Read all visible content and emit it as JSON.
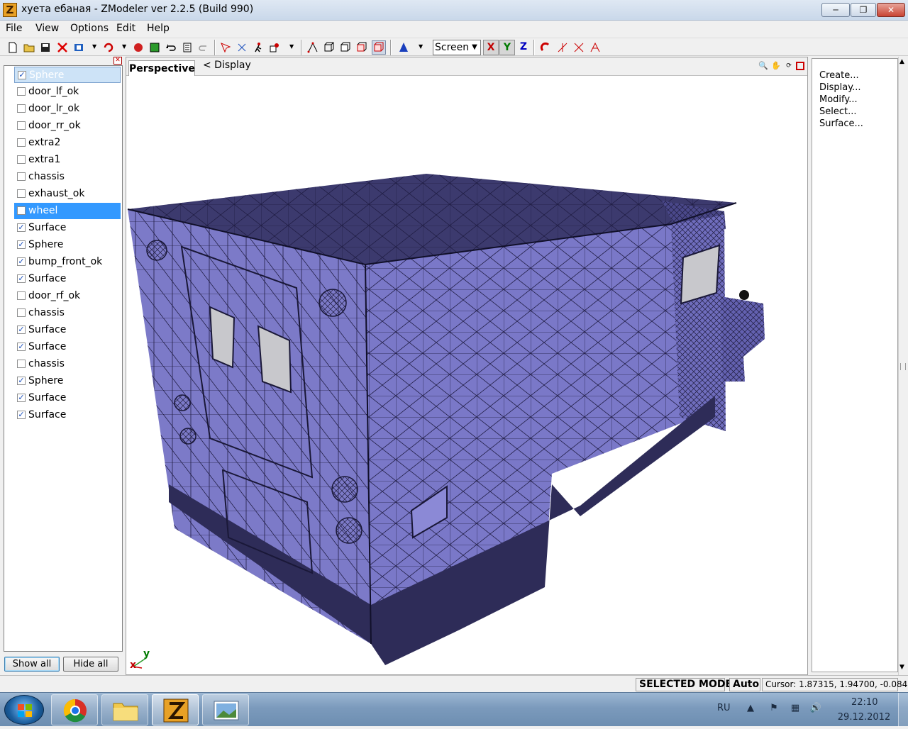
{
  "window": {
    "title": "хуета ебаная - ZModeler ver 2.2.5 (Build 990)",
    "app_icon_letter": "Z"
  },
  "menu": [
    "File",
    "View",
    "Options",
    "Edit",
    "Help"
  ],
  "toolbar": {
    "axis_mode": "Screen",
    "axes": [
      "X",
      "Y",
      "Z"
    ],
    "axis_colors": {
      "X": "#c00000",
      "Y": "#007a00",
      "Z": "#0000c0"
    }
  },
  "object_list": {
    "items": [
      {
        "name": "Sphere",
        "checked": true
      },
      {
        "name": "door_lf_ok",
        "checked": false
      },
      {
        "name": "door_lr_ok",
        "checked": false
      },
      {
        "name": "door_rr_ok",
        "checked": false
      },
      {
        "name": "extra2",
        "checked": false
      },
      {
        "name": "extra1",
        "checked": false
      },
      {
        "name": "chassis",
        "checked": false
      },
      {
        "name": "exhaust_ok",
        "checked": false
      },
      {
        "name": "wheel",
        "checked": false
      },
      {
        "name": "Surface",
        "checked": true
      },
      {
        "name": "Sphere",
        "checked": true
      },
      {
        "name": "bump_front_ok",
        "checked": true
      },
      {
        "name": "Surface",
        "checked": true
      },
      {
        "name": "door_rf_ok",
        "checked": false
      },
      {
        "name": "chassis",
        "checked": false
      },
      {
        "name": "Surface",
        "checked": true
      },
      {
        "name": "Surface",
        "checked": true
      },
      {
        "name": "chassis",
        "checked": false
      },
      {
        "name": "Sphere",
        "checked": true
      },
      {
        "name": "Surface",
        "checked": true
      },
      {
        "name": "Surface",
        "checked": true
      }
    ],
    "show_all_label": "Show all",
    "hide_all_label": "Hide all"
  },
  "viewport": {
    "tab_label": "Perspective",
    "display_label": "<  Display",
    "axis_y_label": "y",
    "axis_x_label": "x",
    "mesh_color": "#7a78c8"
  },
  "rollout": {
    "items": [
      "Create...",
      "Display...",
      "Modify...",
      "Select...",
      "Surface..."
    ]
  },
  "status": {
    "mode": "SELECTED MODE",
    "auto": "Auto",
    "cursor": "Cursor: 1.87315, 1.94700, -0.084"
  },
  "taskbar": {
    "lang": "RU",
    "time": "22:10",
    "date": "29.12.2012"
  }
}
